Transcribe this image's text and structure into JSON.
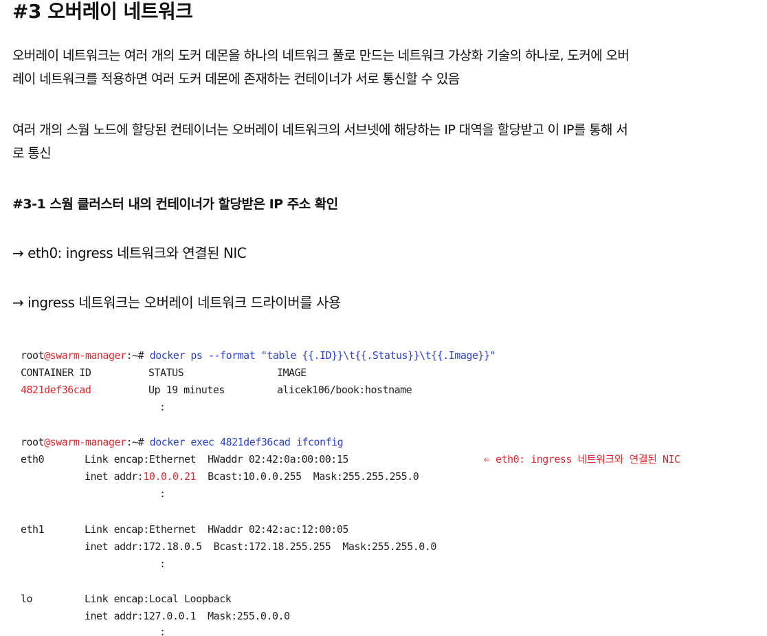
{
  "heading": "#3 오버레이 네트워크",
  "para1": {
    "line1": "오버레이 네트워크는 여러 개의 도커 데몬을 하나의 네트워크 풀로 만드는 네트워크 가상화 기술의 하나로, 도커에 오버",
    "line2": "레이 네트워크를 적용하면 여러 도커 데몬에 존재하는 컨테이너가 서로 통신할 수 있음"
  },
  "para2": {
    "line1": "여러 개의 스웜 노드에 할당된 컨테이너는 오버레이 네트워크의 서브넷에 해당하는 IP 대역을 할당받고 이 IP를 통해 서",
    "line2": "로 통신"
  },
  "subheading": "#3-1 스웜 클러스터 내의 컨테이너가 할당받은 IP 주소 확인",
  "arrow1": "→ eth0: ingress 네트워크와 연결된 NIC",
  "arrow2": "→ ingress 네트워크는 오버레이 네트워크 드라이버를 사용",
  "terminal": {
    "prompt_user": "root",
    "prompt_at": "@",
    "prompt_host": "swarm-manager",
    "prompt_suffix": ":~#",
    "cmd1": "docker ps --format \"table {{.ID}}\\t{{.Status}}\\t{{.Image}}\"",
    "headers": [
      "CONTAINER ID",
      "STATUS",
      "IMAGE"
    ],
    "row": [
      "4821def36cad",
      "Up 19 minutes",
      "alicek106/book:hostname"
    ],
    "ellipsis": ":",
    "cmd2": "docker exec 4821def36cad ifconfig",
    "eth0_name": "eth0",
    "eth0_line1": "Link encap:Ethernet  HWaddr 02:42:0a:00:00:15",
    "eth0_note": "⇐ eth0: ingress 네트워크와 연결된 NIC",
    "eth0_inet_prefix": "inet addr:",
    "eth0_inet_ip": "10.0.0.21",
    "eth0_inet_rest": "  Bcast:10.0.0.255  Mask:255.255.255.0",
    "eth1_name": "eth1",
    "eth1_line1": "Link encap:Ethernet  HWaddr 02:42:ac:12:00:05",
    "eth1_line2": "inet addr:172.18.0.5  Bcast:172.18.255.255  Mask:255.255.0.0",
    "lo_name": "lo",
    "lo_line1": "Link encap:Local Loopback",
    "lo_line2": "inet addr:127.0.0.1  Mask:255.0.0.0"
  },
  "colors": {
    "red": "#e0282e",
    "blue": "#2a3fd6"
  }
}
